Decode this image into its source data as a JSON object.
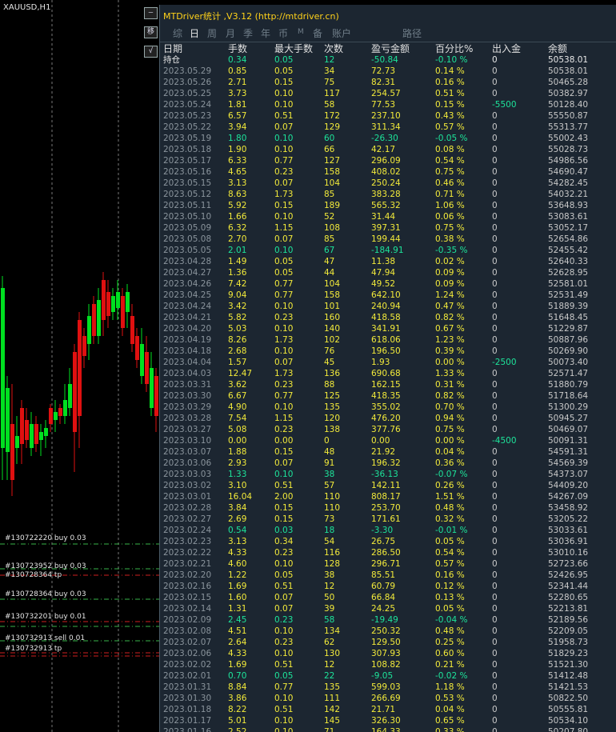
{
  "symbol": "XAUUSD,H1",
  "side_buttons": [
    "—",
    "移",
    "√"
  ],
  "panel_title": "MTDriver统计 ,V3.12 (http://mtdriver.cn)",
  "tabs": [
    "综",
    "日",
    "周",
    "月",
    "季",
    "年",
    "币",
    "M",
    "备",
    "账户",
    "路径"
  ],
  "active_tab": "日",
  "columns": [
    "日期",
    "手数",
    "最大手数",
    "次数",
    "盈亏金额",
    "百分比%",
    "出入金",
    "余额"
  ],
  "rows": [
    [
      "持仓",
      "0.34",
      "0.05",
      "12",
      "-50.84",
      "-0.10 %",
      "0",
      "50538.01"
    ],
    [
      "2023.05.29",
      "0.85",
      "0.05",
      "34",
      "72.73",
      "0.14 %",
      "0",
      "50538.01"
    ],
    [
      "2023.05.26",
      "2.71",
      "0.15",
      "75",
      "82.31",
      "0.16 %",
      "0",
      "50465.28"
    ],
    [
      "2023.05.25",
      "3.73",
      "0.10",
      "117",
      "254.57",
      "0.51 %",
      "0",
      "50382.97"
    ],
    [
      "2023.05.24",
      "1.81",
      "0.10",
      "58",
      "77.53",
      "0.15 %",
      "-5500",
      "50128.40"
    ],
    [
      "2023.05.23",
      "6.57",
      "0.51",
      "172",
      "237.10",
      "0.43 %",
      "0",
      "55550.87"
    ],
    [
      "2023.05.22",
      "3.94",
      "0.07",
      "129",
      "311.34",
      "0.57 %",
      "0",
      "55313.77"
    ],
    [
      "2023.05.19",
      "1.80",
      "0.10",
      "60",
      "-26.30",
      "-0.05 %",
      "0",
      "55002.43"
    ],
    [
      "2023.05.18",
      "1.90",
      "0.10",
      "66",
      "42.17",
      "0.08 %",
      "0",
      "55028.73"
    ],
    [
      "2023.05.17",
      "6.33",
      "0.77",
      "127",
      "296.09",
      "0.54 %",
      "0",
      "54986.56"
    ],
    [
      "2023.05.16",
      "4.65",
      "0.23",
      "158",
      "408.02",
      "0.75 %",
      "0",
      "54690.47"
    ],
    [
      "2023.05.15",
      "3.13",
      "0.07",
      "104",
      "250.24",
      "0.46 %",
      "0",
      "54282.45"
    ],
    [
      "2023.05.12",
      "8.63",
      "1.73",
      "85",
      "383.28",
      "0.71 %",
      "0",
      "54032.21"
    ],
    [
      "2023.05.11",
      "5.92",
      "0.15",
      "189",
      "565.32",
      "1.06 %",
      "0",
      "53648.93"
    ],
    [
      "2023.05.10",
      "1.66",
      "0.10",
      "52",
      "31.44",
      "0.06 %",
      "0",
      "53083.61"
    ],
    [
      "2023.05.09",
      "6.32",
      "1.15",
      "108",
      "397.31",
      "0.75 %",
      "0",
      "53052.17"
    ],
    [
      "2023.05.08",
      "2.70",
      "0.07",
      "85",
      "199.44",
      "0.38 %",
      "0",
      "52654.86"
    ],
    [
      "2023.05.05",
      "2.01",
      "0.10",
      "67",
      "-184.91",
      "-0.35 %",
      "0",
      "52455.42"
    ],
    [
      "2023.04.28",
      "1.49",
      "0.05",
      "47",
      "11.38",
      "0.02 %",
      "0",
      "52640.33"
    ],
    [
      "2023.04.27",
      "1.36",
      "0.05",
      "44",
      "47.94",
      "0.09 %",
      "0",
      "52628.95"
    ],
    [
      "2023.04.26",
      "7.42",
      "0.77",
      "104",
      "49.52",
      "0.09 %",
      "0",
      "52581.01"
    ],
    [
      "2023.04.25",
      "9.04",
      "0.77",
      "158",
      "642.10",
      "1.24 %",
      "0",
      "52531.49"
    ],
    [
      "2023.04.24",
      "3.42",
      "0.10",
      "101",
      "240.94",
      "0.47 %",
      "0",
      "51889.39"
    ],
    [
      "2023.04.21",
      "5.82",
      "0.23",
      "160",
      "418.58",
      "0.82 %",
      "0",
      "51648.45"
    ],
    [
      "2023.04.20",
      "5.03",
      "0.10",
      "140",
      "341.91",
      "0.67 %",
      "0",
      "51229.87"
    ],
    [
      "2023.04.19",
      "8.26",
      "1.73",
      "102",
      "618.06",
      "1.23 %",
      "0",
      "50887.96"
    ],
    [
      "2023.04.18",
      "2.68",
      "0.10",
      "76",
      "196.50",
      "0.39 %",
      "0",
      "50269.90"
    ],
    [
      "2023.04.04",
      "1.57",
      "0.07",
      "45",
      "1.93",
      "0.00 %",
      "-2500",
      "50073.40"
    ],
    [
      "2023.04.03",
      "12.47",
      "1.73",
      "136",
      "690.68",
      "1.33 %",
      "0",
      "52571.47"
    ],
    [
      "2023.03.31",
      "3.62",
      "0.23",
      "88",
      "162.15",
      "0.31 %",
      "0",
      "51880.79"
    ],
    [
      "2023.03.30",
      "6.67",
      "0.77",
      "125",
      "418.35",
      "0.82 %",
      "0",
      "51718.64"
    ],
    [
      "2023.03.29",
      "4.90",
      "0.10",
      "135",
      "355.02",
      "0.70 %",
      "0",
      "51300.29"
    ],
    [
      "2023.03.28",
      "7.54",
      "1.15",
      "120",
      "476.20",
      "0.94 %",
      "0",
      "50945.27"
    ],
    [
      "2023.03.27",
      "5.08",
      "0.23",
      "138",
      "377.76",
      "0.75 %",
      "0",
      "50469.07"
    ],
    [
      "2023.03.10",
      "0.00",
      "0.00",
      "0",
      "0.00",
      "0.00 %",
      "-4500",
      "50091.31"
    ],
    [
      "2023.03.07",
      "1.88",
      "0.15",
      "48",
      "21.92",
      "0.04 %",
      "0",
      "54591.31"
    ],
    [
      "2023.03.06",
      "2.93",
      "0.07",
      "91",
      "196.32",
      "0.36 %",
      "0",
      "54569.39"
    ],
    [
      "2023.03.03",
      "1.33",
      "0.10",
      "38",
      "-36.13",
      "-0.07 %",
      "0",
      "54373.07"
    ],
    [
      "2023.03.02",
      "3.10",
      "0.51",
      "57",
      "142.11",
      "0.26 %",
      "0",
      "54409.20"
    ],
    [
      "2023.03.01",
      "16.04",
      "2.00",
      "110",
      "808.17",
      "1.51 %",
      "0",
      "54267.09"
    ],
    [
      "2023.02.28",
      "3.84",
      "0.15",
      "110",
      "253.70",
      "0.48 %",
      "0",
      "53458.92"
    ],
    [
      "2023.02.27",
      "2.69",
      "0.15",
      "73",
      "171.61",
      "0.32 %",
      "0",
      "53205.22"
    ],
    [
      "2023.02.24",
      "0.54",
      "0.03",
      "18",
      "-3.30",
      "-0.01 %",
      "0",
      "53033.61"
    ],
    [
      "2023.02.23",
      "3.13",
      "0.34",
      "54",
      "26.75",
      "0.05 %",
      "0",
      "53036.91"
    ],
    [
      "2023.02.22",
      "4.33",
      "0.23",
      "116",
      "286.50",
      "0.54 %",
      "0",
      "53010.16"
    ],
    [
      "2023.02.21",
      "4.60",
      "0.10",
      "128",
      "296.71",
      "0.57 %",
      "0",
      "52723.66"
    ],
    [
      "2023.02.20",
      "1.22",
      "0.05",
      "38",
      "85.51",
      "0.16 %",
      "0",
      "52426.95"
    ],
    [
      "2023.02.16",
      "1.69",
      "0.51",
      "12",
      "60.79",
      "0.12 %",
      "0",
      "52341.44"
    ],
    [
      "2023.02.15",
      "1.60",
      "0.07",
      "50",
      "66.84",
      "0.13 %",
      "0",
      "52280.65"
    ],
    [
      "2023.02.14",
      "1.31",
      "0.07",
      "39",
      "24.25",
      "0.05 %",
      "0",
      "52213.81"
    ],
    [
      "2023.02.09",
      "2.45",
      "0.23",
      "58",
      "-19.49",
      "-0.04 %",
      "0",
      "52189.56"
    ],
    [
      "2023.02.08",
      "4.51",
      "0.10",
      "134",
      "250.32",
      "0.48 %",
      "0",
      "52209.05"
    ],
    [
      "2023.02.07",
      "2.64",
      "0.23",
      "62",
      "129.50",
      "0.25 %",
      "0",
      "51958.73"
    ],
    [
      "2023.02.06",
      "4.33",
      "0.10",
      "130",
      "307.93",
      "0.60 %",
      "0",
      "51829.23"
    ],
    [
      "2023.02.02",
      "1.69",
      "0.51",
      "12",
      "108.82",
      "0.21 %",
      "0",
      "51521.30"
    ],
    [
      "2023.02.01",
      "0.70",
      "0.05",
      "22",
      "-9.05",
      "-0.02 %",
      "0",
      "51412.48"
    ],
    [
      "2023.01.31",
      "8.84",
      "0.77",
      "135",
      "599.03",
      "1.18 %",
      "0",
      "51421.53"
    ],
    [
      "2023.01.30",
      "3.86",
      "0.10",
      "111",
      "266.69",
      "0.53 %",
      "0",
      "50822.50"
    ],
    [
      "2023.01.18",
      "8.22",
      "0.51",
      "142",
      "21.71",
      "0.04 %",
      "0",
      "50555.81"
    ],
    [
      "2023.01.17",
      "5.01",
      "0.10",
      "145",
      "326.30",
      "0.65 %",
      "0",
      "50534.10"
    ],
    [
      "2023.01.16",
      "2.52",
      "0.10",
      "71",
      "164.33",
      "0.33 %",
      "0",
      "50207.80"
    ]
  ],
  "order_labels": [
    "#130722220 buy 0.03",
    "#130723952 buy 0.03",
    "#130728364 tp",
    "#130728364 buy 0.03",
    "#130732201 buy 0.01",
    "#130732913 sell 0.01",
    "#130732913 tp"
  ],
  "colors": {
    "profit": "#f2ea3a",
    "loss": "#1de39a",
    "title": "#ffd21a",
    "bull": "#00e020",
    "bear": "#e01010"
  }
}
